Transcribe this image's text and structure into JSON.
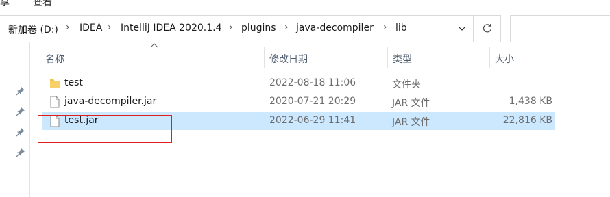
{
  "ribbon": {
    "tabs": [
      "享",
      "查看"
    ]
  },
  "address": {
    "crumbs": [
      "新加卷 (D:)",
      "IDEA",
      "IntelliJ IDEA 2020.1.4",
      "plugins",
      "java-decompiler",
      "lib"
    ]
  },
  "columns": {
    "name": "名称",
    "date": "修改日期",
    "type": "类型",
    "size": "大小"
  },
  "files": [
    {
      "name": "test",
      "date": "2022-08-18 11:06",
      "type": "文件夹",
      "size": "",
      "icon": "folder-icon"
    },
    {
      "name": "java-decompiler.jar",
      "date": "2020-07-21 20:29",
      "type": "JAR 文件",
      "size": "1,438 KB",
      "icon": "file-icon"
    },
    {
      "name": "test.jar",
      "date": "2022-06-29 11:41",
      "type": "JAR 文件",
      "size": "22,816 KB",
      "icon": "file-icon",
      "selected": true
    }
  ],
  "colors": {
    "selection": "#cce8ff",
    "annotation": "#e02020",
    "folder": "#f0c24a"
  }
}
